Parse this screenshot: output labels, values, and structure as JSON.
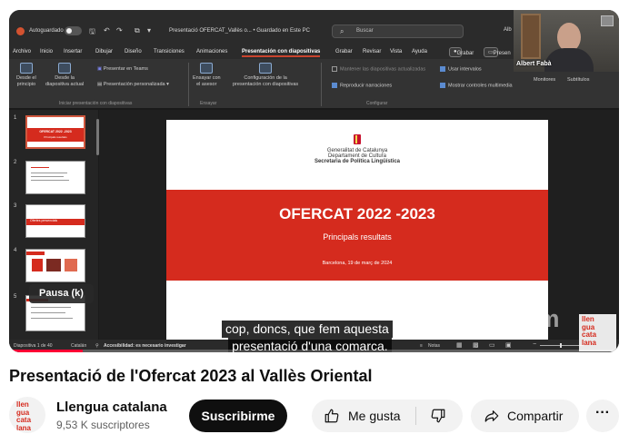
{
  "video": {
    "title": "Presentació de l'Ofercat 2023 al Vallès Oriental",
    "progress_fraction": 0.12,
    "pause_tooltip": "Pausa (k)",
    "caption_line1": "cop, doncs, que fem aquesta",
    "caption_line2": "presentació d'una comarca.",
    "watermark": "zoom",
    "corner_logo": [
      "llen",
      "gua",
      "cata",
      "lana"
    ]
  },
  "powerpoint": {
    "autosave_label": "Autoguardado",
    "doc_title": "Presentació OFERCAT_Vallès o... • Guardado en Este PC",
    "search_placeholder": "Buscar",
    "user_name": "Alb",
    "menu": [
      "Archivo",
      "Inicio",
      "Insertar",
      "Dibujar",
      "Diseño",
      "Transiciones",
      "Animaciones",
      "Presentación con diapositivas",
      "Grabar",
      "Revisar",
      "Vista",
      "Ayuda"
    ],
    "record_button": "Grabar",
    "present_button": "Presen",
    "ribbon": {
      "from_start": [
        "Desde el",
        "principio"
      ],
      "from_current": [
        "Desde la",
        "diapositiva actual"
      ],
      "present_teams": "Presentar en Teams",
      "custom_show": "Presentación personalizada",
      "group_start": "Iniciar presentación con diapositivas",
      "rehearse": [
        "Ensayar con",
        "el asesor"
      ],
      "setup": [
        "Configuración de la",
        "presentación con diapositivas"
      ],
      "group_rehearse": "Ensayar",
      "keep_updated": "Mantener las diapositivas actualizadas",
      "play_narrations": "Reproducir narraciones",
      "use_timings": "Usar intervalos",
      "show_media_controls": "Mostrar controles multimedia",
      "group_configure": "Configurar",
      "monitors": "Monitores",
      "subtitles": "Subtítulos"
    },
    "thumbnails": [
      {
        "num": "1",
        "title": "OFERCAT 2022 -2023",
        "sub": "Principals resultats"
      },
      {
        "num": "2"
      },
      {
        "num": "3",
        "title": "Ofertes presencials"
      },
      {
        "num": "4"
      },
      {
        "num": "5"
      }
    ],
    "slide": {
      "org1": "Generalitat de Catalunya",
      "org2": "Departament de Cultura",
      "org3": "Secretaria de Política Lingüística",
      "title": "OFERCAT 2022 -2023",
      "subtitle": "Principals resultats",
      "date": "Barcelona, 19 de març de 2024"
    },
    "status": {
      "slide_of": "Diapositiva 1 de 40",
      "language": "Catalán",
      "accessibility": "Accesibilidad: es necesario investigar",
      "notes": "Notas"
    }
  },
  "webcam": {
    "name": "Albert Fabà"
  },
  "channel": {
    "logo": [
      "llen",
      "gua",
      "cata",
      "lana"
    ],
    "name": "Llengua catalana",
    "subscribers": "9,53 K suscriptores",
    "subscribe_label": "Suscribirme"
  },
  "actions": {
    "like_label": "Me gusta",
    "share_label": "Compartir",
    "more_label": "···"
  },
  "colors": {
    "accent_red": "#d52b1e",
    "youtube_red": "#ff0033",
    "button_bg": "#f2f2f2"
  }
}
